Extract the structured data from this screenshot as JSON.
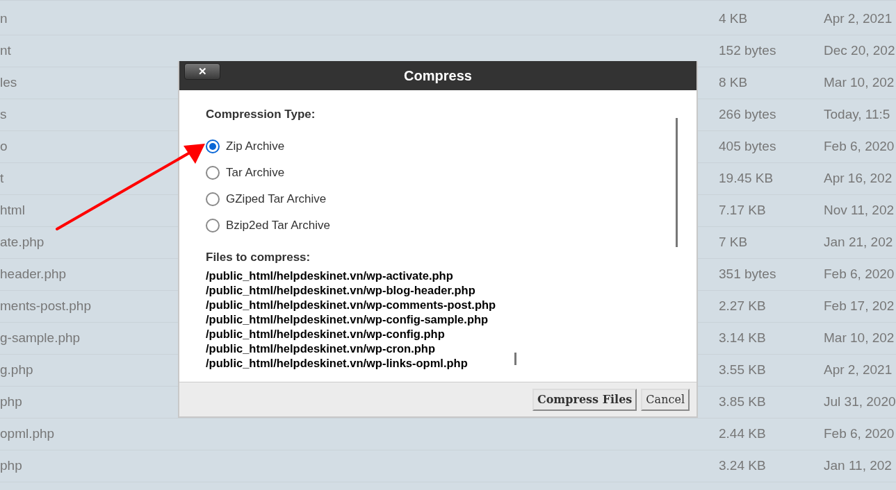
{
  "file_rows": [
    {
      "name": "n",
      "size": "4 KB",
      "modified": "Apr 2, 2021"
    },
    {
      "name": "nt",
      "size": "152 bytes",
      "modified": "Dec 20, 202"
    },
    {
      "name": "les",
      "size": "8 KB",
      "modified": "Mar 10, 202"
    },
    {
      "name": "s",
      "size": "266 bytes",
      "modified": "Today, 11:5"
    },
    {
      "name": "o",
      "size": "405 bytes",
      "modified": "Feb 6, 2020"
    },
    {
      "name": "t",
      "size": "19.45 KB",
      "modified": "Apr 16, 202"
    },
    {
      "name": "html",
      "size": "7.17 KB",
      "modified": "Nov 11, 202"
    },
    {
      "name": "ate.php",
      "size": "7 KB",
      "modified": "Jan 21, 202"
    },
    {
      "name": "header.php",
      "size": "351 bytes",
      "modified": "Feb 6, 2020"
    },
    {
      "name": "ments-post.php",
      "size": "2.27 KB",
      "modified": "Feb 17, 202"
    },
    {
      "name": "g-sample.php",
      "size": "3.14 KB",
      "modified": "Mar 10, 202"
    },
    {
      "name": "g.php",
      "size": "3.55 KB",
      "modified": "Apr 2, 2021"
    },
    {
      "name": "php",
      "size": "3.85 KB",
      "modified": "Jul 31, 2020"
    },
    {
      "name": "opml.php",
      "size": "2.44 KB",
      "modified": "Feb 6, 2020"
    },
    {
      "name": "php",
      "size": "3.24 KB",
      "modified": "Jan 11, 202"
    }
  ],
  "dialog": {
    "title": "Compress",
    "close": "✕",
    "type_label": "Compression Type:",
    "compression_types": [
      {
        "label": "Zip Archive",
        "selected": true
      },
      {
        "label": "Tar Archive",
        "selected": false
      },
      {
        "label": "GZiped Tar Archive",
        "selected": false
      },
      {
        "label": "Bzip2ed Tar Archive",
        "selected": false
      }
    ],
    "files_label": "Files to compress:",
    "files": [
      "/public_html/helpdeskinet.vn/wp-activate.php",
      "/public_html/helpdeskinet.vn/wp-blog-header.php",
      "/public_html/helpdeskinet.vn/wp-comments-post.php",
      "/public_html/helpdeskinet.vn/wp-config-sample.php",
      "/public_html/helpdeskinet.vn/wp-config.php",
      "/public_html/helpdeskinet.vn/wp-cron.php",
      "/public_html/helpdeskinet.vn/wp-links-opml.php"
    ],
    "buttons": [
      {
        "label": "Compress Files",
        "kind": "primary"
      },
      {
        "label": "Cancel",
        "kind": "secondary"
      }
    ]
  }
}
